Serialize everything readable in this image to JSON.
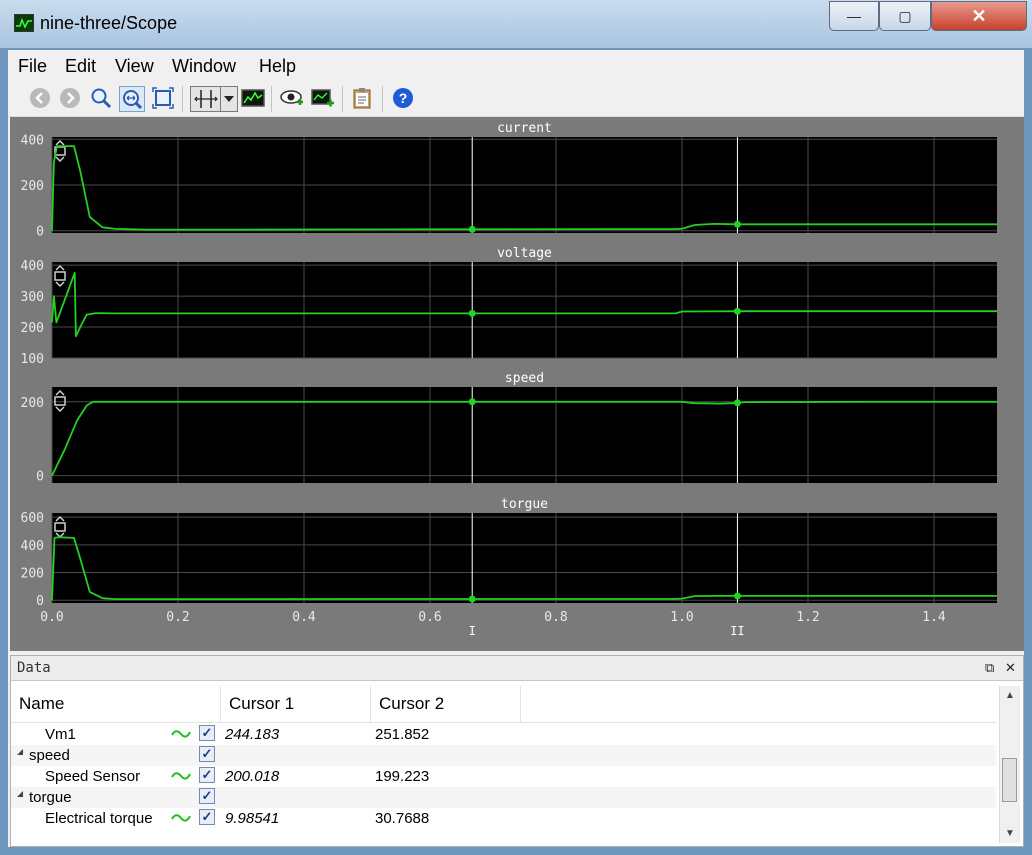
{
  "window": {
    "title": "nine-three/Scope",
    "minimize": "—",
    "maximize": "▢",
    "close": "✕"
  },
  "menu": [
    "File",
    "Edit",
    "View",
    "Window",
    "Help"
  ],
  "toolbar": [
    {
      "name": "back-icon",
      "kind": "circle-left"
    },
    {
      "name": "forward-icon",
      "kind": "circle-right"
    },
    {
      "name": "zoom-icon",
      "kind": "magnifier"
    },
    {
      "name": "zoom-x-icon",
      "kind": "magnifier-x"
    },
    {
      "name": "fit-view-icon",
      "kind": "fit"
    },
    {
      "name": "cursor-measure-icon",
      "kind": "cursor"
    },
    {
      "name": "cursor-dropdown-icon",
      "kind": "dropdown"
    },
    {
      "name": "signal-stats-icon",
      "kind": "stats"
    },
    {
      "name": "view-signals-icon",
      "kind": "eye"
    },
    {
      "name": "add-plot-icon",
      "kind": "addplot"
    },
    {
      "name": "clipboard-icon",
      "kind": "clipboard"
    },
    {
      "name": "help-icon",
      "kind": "help"
    }
  ],
  "colors": {
    "plot_bg": "#000000",
    "trace": "#23d123",
    "grid": "#4a4a4a",
    "cursor": "#ffffff",
    "area_bg": "#7a7a7a"
  },
  "chart_data": [
    {
      "type": "line",
      "title": "current",
      "xlim": [
        0,
        1.5
      ],
      "ylim": [
        -10,
        410
      ],
      "yticks": [
        0,
        200,
        400
      ],
      "x": [
        0,
        0.003,
        0.008,
        0.035,
        0.045,
        0.06,
        0.08,
        0.1,
        0.15,
        0.3,
        0.6,
        0.9,
        0.99,
        1.0,
        1.02,
        1.05,
        1.09,
        1.2,
        1.4,
        1.5
      ],
      "y": [
        0,
        300,
        370,
        370,
        260,
        60,
        15,
        8,
        5,
        5,
        6,
        7,
        7,
        9,
        25,
        30,
        28,
        28,
        28,
        28
      ]
    },
    {
      "type": "line",
      "title": "voltage",
      "xlim": [
        0,
        1.5
      ],
      "ylim": [
        100,
        410
      ],
      "yticks": [
        100,
        200,
        300,
        400
      ],
      "x": [
        0,
        0.003,
        0.007,
        0.036,
        0.038,
        0.045,
        0.055,
        0.07,
        0.1,
        0.3,
        0.6,
        0.99,
        1.0,
        1.1,
        1.3,
        1.5
      ],
      "y": [
        215,
        300,
        215,
        375,
        170,
        200,
        240,
        245,
        244,
        244,
        244,
        244,
        250,
        251,
        251,
        251
      ]
    },
    {
      "type": "line",
      "title": "speed",
      "xlim": [
        0,
        1.5
      ],
      "ylim": [
        -20,
        240
      ],
      "yticks": [
        0,
        200
      ],
      "x": [
        0,
        0.02,
        0.04,
        0.055,
        0.065,
        0.1,
        0.5,
        1.0,
        1.02,
        1.06,
        1.08,
        1.1,
        1.3,
        1.5
      ],
      "y": [
        0,
        70,
        150,
        190,
        200,
        200,
        200,
        200,
        196,
        195,
        196,
        199,
        200,
        200
      ]
    },
    {
      "type": "line",
      "title": "torgue",
      "xlim": [
        0,
        1.5
      ],
      "xticks": [
        0.0,
        0.2,
        0.4,
        0.6,
        0.8,
        1.0,
        1.2,
        1.4
      ],
      "ylim": [
        -20,
        630
      ],
      "yticks": [
        0,
        200,
        400,
        600
      ],
      "x": [
        0,
        0.004,
        0.01,
        0.035,
        0.045,
        0.06,
        0.08,
        0.1,
        0.3,
        0.6,
        0.99,
        1.0,
        1.02,
        1.05,
        1.2,
        1.5
      ],
      "y": [
        0,
        450,
        455,
        450,
        300,
        60,
        15,
        8,
        8,
        9,
        9,
        12,
        30,
        31,
        31,
        31
      ]
    }
  ],
  "cursors": [
    {
      "label": "I",
      "x": 0.667
    },
    {
      "label": "II",
      "x": 1.088
    }
  ],
  "data_panel": {
    "title": "Data",
    "float_icon": "⧉",
    "close_icon": "✕",
    "columns": [
      "Name",
      "Cursor 1",
      "Cursor 2"
    ],
    "rows": [
      {
        "name": "Vm1",
        "level": 1,
        "signal": true,
        "checked": true,
        "cursor1": "244.183",
        "cursor2": "251.852"
      },
      {
        "name": "speed",
        "level": 0,
        "signal": false,
        "checked": true,
        "cursor1": "",
        "cursor2": ""
      },
      {
        "name": "Speed Sensor",
        "level": 1,
        "signal": true,
        "checked": true,
        "cursor1": "200.018",
        "cursor2": "199.223"
      },
      {
        "name": "torgue",
        "level": 0,
        "signal": false,
        "checked": true,
        "cursor1": "",
        "cursor2": ""
      },
      {
        "name": "Electrical torque",
        "level": 1,
        "signal": true,
        "checked": true,
        "cursor1": "9.98541",
        "cursor2": "30.7688"
      }
    ]
  }
}
